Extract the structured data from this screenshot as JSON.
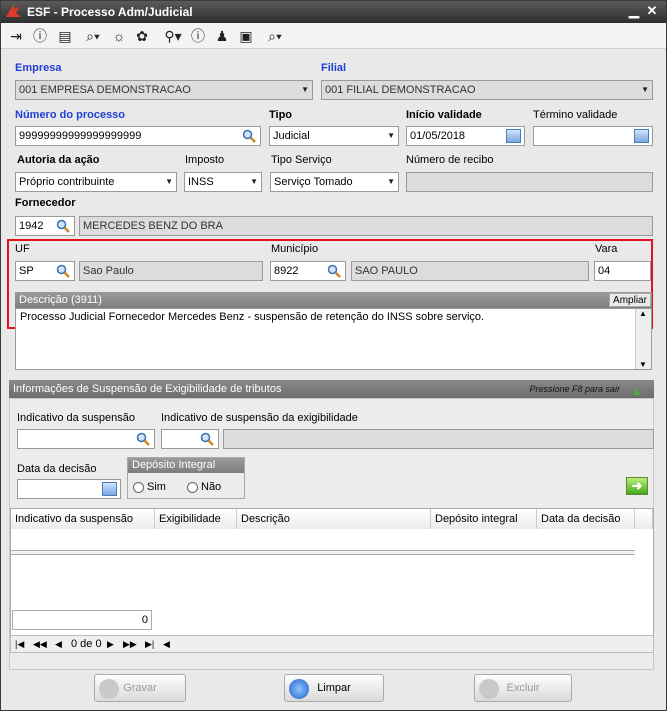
{
  "window": {
    "title": "ESF - Processo Adm/Judicial"
  },
  "form": {
    "empresa_label": "Empresa",
    "empresa_value": "001 EMPRESA DEMONSTRACAO",
    "filial_label": "Filial",
    "filial_value": "001 FILIAL DEMONSTRACAO",
    "numero_label": "Número do processo",
    "numero_value": "99999999999999999999",
    "tipo_label": "Tipo",
    "tipo_value": "Judicial",
    "inicio_label": "Início validade",
    "inicio_value": "01/05/2018",
    "termino_label": "Término validade",
    "termino_value": "",
    "autoria_label": "Autoria da ação",
    "autoria_value": "Próprio contribuinte",
    "imposto_label": "Imposto",
    "imposto_value": "INSS",
    "tiposervico_label": "Tipo Serviço",
    "tiposervico_value": "Serviço Tomado",
    "recibo_label": "Número de recibo",
    "recibo_value": "",
    "fornecedor_label": "Fornecedor",
    "fornecedor_code": "1942",
    "fornecedor_name": "MERCEDES BENZ DO BRA",
    "uf_label": "UF",
    "uf_value": "SP",
    "uf_name": "Sao Paulo",
    "municipio_label": "Município",
    "municipio_code": "8922",
    "municipio_name": "SAO PAULO",
    "vara_label": "Vara",
    "vara_value": "04",
    "descricao_header": "Descrição (3911)",
    "ampliar_label": "Ampliar",
    "descricao_value": "Processo Judicial Fornecedor Mercedes Benz - suspensão de retenção do INSS sobre serviço."
  },
  "suspensao": {
    "section_title": "Informações de Suspensão de Exigibilidade de tributos",
    "hint": "Pressione F8 para sair",
    "indicativo_label": "Indicativo da suspensão",
    "indicativo_exig_label": "Indicativo de suspensão da exigibilidade",
    "data_decisao_label": "Data da decisão",
    "deposito_title": "Depósito Integral",
    "sim_label": "Sim",
    "nao_label": "Não",
    "columns": [
      "Indicativo da suspensão",
      "Exigibilidade",
      "Descrição",
      "Depósito integral",
      "Data da decisão"
    ],
    "total": "0",
    "pager": "0 de 0"
  },
  "buttons": {
    "gravar": "Gravar",
    "limpar": "Limpar",
    "excluir": "Excluir"
  },
  "colors": {
    "accent_blue": "#1f3fd6",
    "highlight_red": "#e3141f"
  }
}
